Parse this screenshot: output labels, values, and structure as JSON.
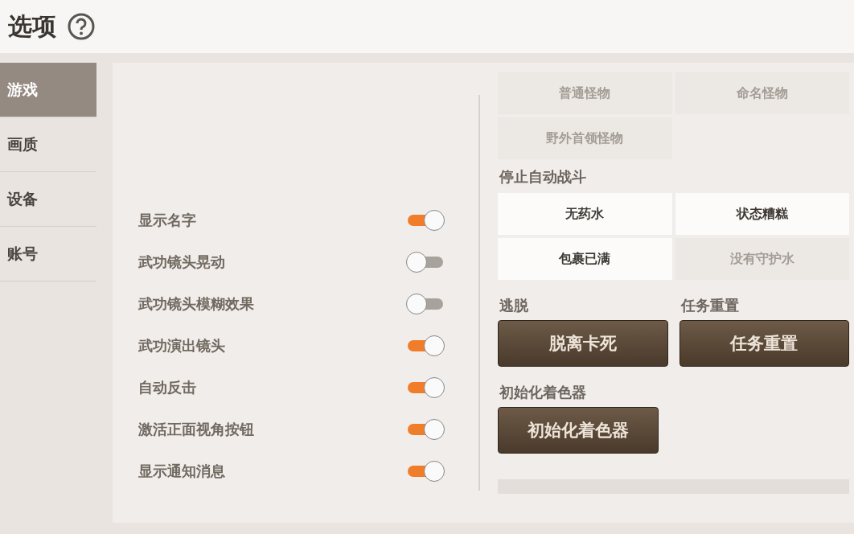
{
  "title": "选项",
  "sidebar": {
    "items": [
      {
        "label": "游戏",
        "selected": true
      },
      {
        "label": "画质",
        "selected": false
      },
      {
        "label": "设备",
        "selected": false
      },
      {
        "label": "账号",
        "selected": false
      }
    ]
  },
  "toggles": [
    {
      "label": "显示名字",
      "on": true
    },
    {
      "label": "武功镜头晃动",
      "on": false
    },
    {
      "label": "武功镜头模糊效果",
      "on": false
    },
    {
      "label": "武功演出镜头",
      "on": true
    },
    {
      "label": "自动反击",
      "on": true
    },
    {
      "label": "激活正面视角按钮",
      "on": true
    },
    {
      "label": "显示通知消息",
      "on": true
    }
  ],
  "target_options": [
    {
      "label": "普通怪物",
      "selected": false
    },
    {
      "label": "命名怪物",
      "selected": false
    },
    {
      "label": "野外首领怪物",
      "selected": false
    }
  ],
  "stop_auto_battle": {
    "title": "停止自动战斗",
    "options": [
      {
        "label": "无药水",
        "selected": true
      },
      {
        "label": "状态糟糕",
        "selected": true
      },
      {
        "label": "包裹已满",
        "selected": true
      },
      {
        "label": "没有守护水",
        "selected": false
      }
    ]
  },
  "actions": [
    {
      "title": "逃脱",
      "button": "脱离卡死"
    },
    {
      "title": "任务重置",
      "button": "任务重置"
    },
    {
      "title": "初始化着色器",
      "button": "初始化着色器"
    }
  ]
}
